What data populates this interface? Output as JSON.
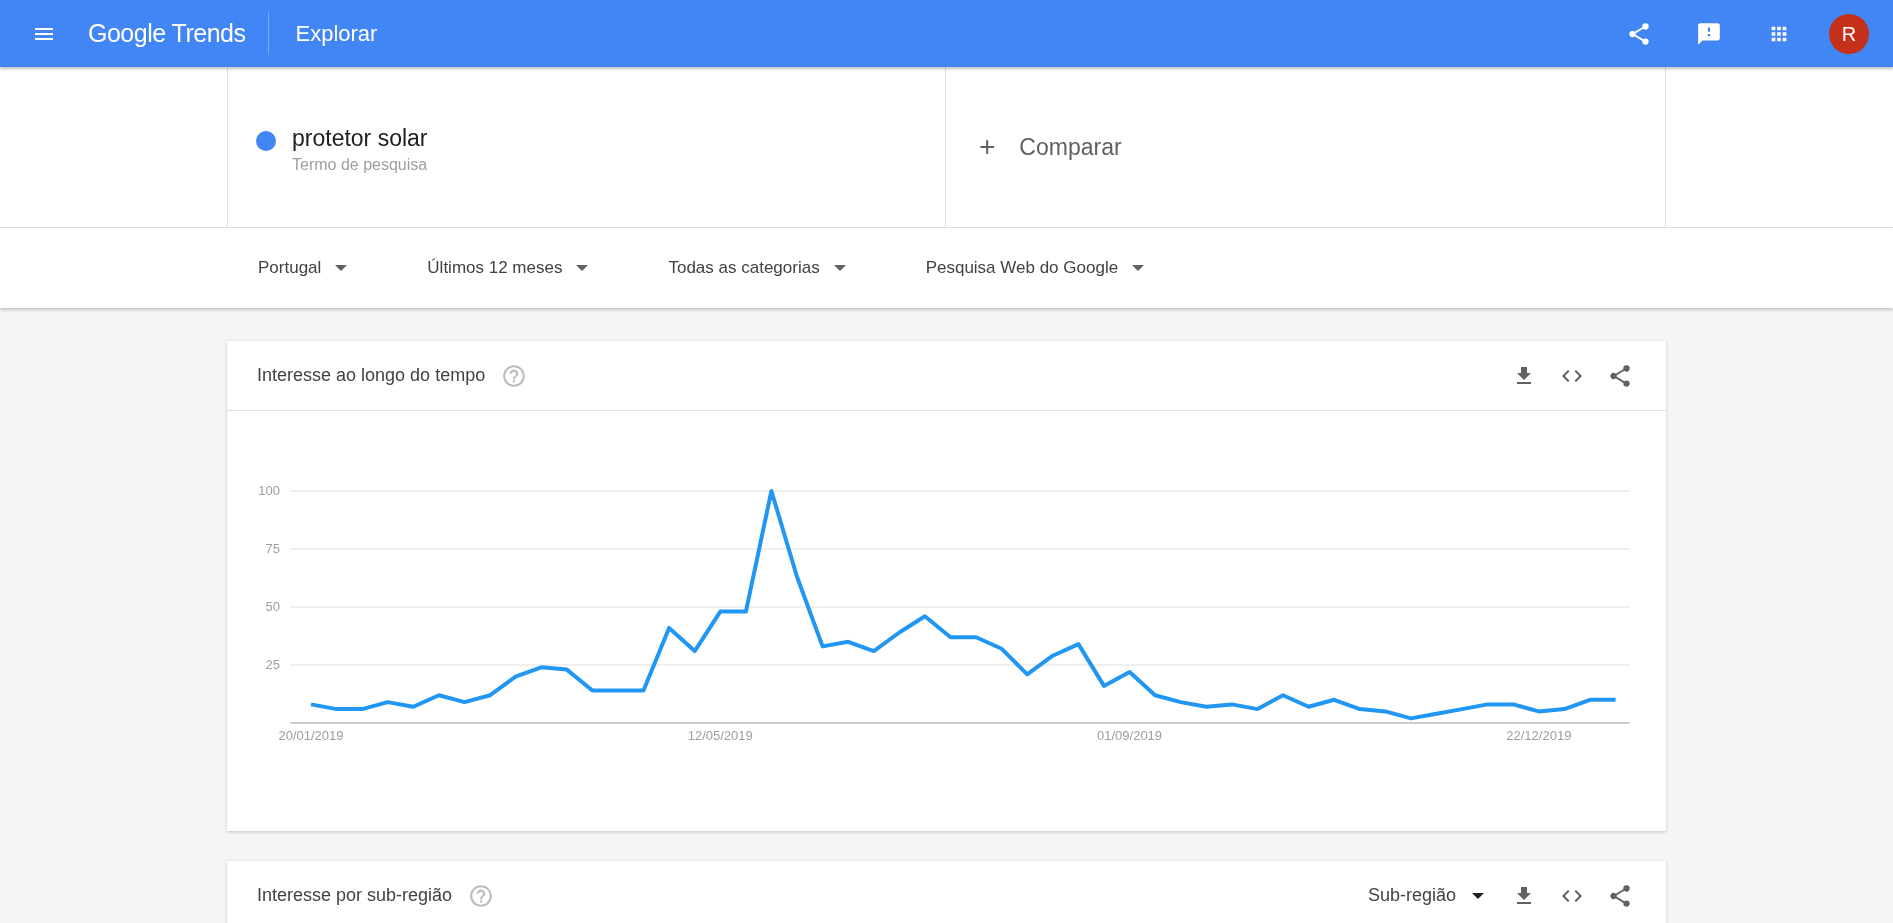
{
  "header": {
    "logo": "Google Trends",
    "title": "Explorar",
    "avatar_letter": "R"
  },
  "search": {
    "term": "protetor solar",
    "subtitle": "Termo de pesquisa",
    "compare_icon": "+",
    "compare": "Comparar"
  },
  "filters": [
    {
      "label": "Portugal"
    },
    {
      "label": "Últimos 12 meses"
    },
    {
      "label": "Todas as categorias"
    },
    {
      "label": "Pesquisa Web do Google"
    }
  ],
  "cards": [
    {
      "title": "Interesse ao longo do tempo",
      "chart_data": {
        "type": "line",
        "categories": [
          "20/01/2019",
          null,
          null,
          null,
          null,
          null,
          null,
          null,
          null,
          null,
          null,
          null,
          null,
          null,
          null,
          null,
          "12/05/2019",
          null,
          null,
          null,
          null,
          null,
          null,
          null,
          null,
          null,
          null,
          null,
          null,
          null,
          null,
          null,
          "01/09/2019",
          null,
          null,
          null,
          null,
          null,
          null,
          null,
          null,
          null,
          null,
          null,
          null,
          null,
          null,
          null,
          "22/12/2019",
          null,
          null,
          null
        ],
        "ylim": [
          0,
          100
        ],
        "grid": true,
        "yticks": [
          25,
          50,
          75,
          100
        ],
        "series": [
          {
            "color": "#2196f3",
            "values": [
              8,
              6,
              6,
              9,
              7,
              12,
              9,
              12,
              20,
              24,
              23,
              14,
              14,
              14,
              41,
              31,
              48,
              48,
              100,
              63,
              33,
              35,
              31,
              39,
              46,
              37,
              37,
              32,
              21,
              29,
              34,
              16,
              22,
              12,
              9,
              7,
              8,
              6,
              12,
              7,
              10,
              6,
              5,
              2,
              4,
              6,
              8,
              8,
              5,
              6,
              10,
              10
            ]
          }
        ]
      }
    },
    {
      "title": "Interesse por sub-região",
      "dropdown": "Sub-região"
    }
  ]
}
